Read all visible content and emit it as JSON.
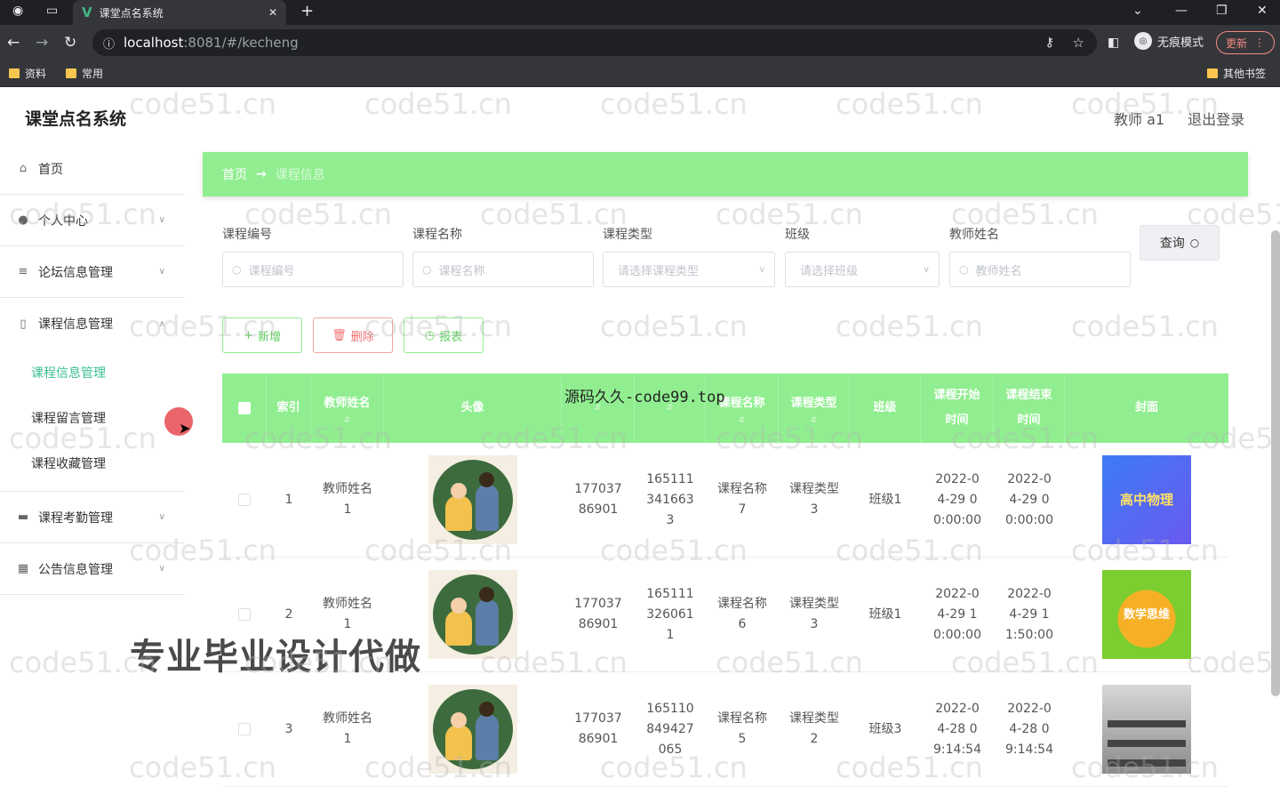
{
  "browser": {
    "tab_title": "课堂点名系统",
    "url_host": "localhost",
    "url_path": ":8081/#/kecheng",
    "incognito_label": "无痕模式",
    "update_label": "更新",
    "bookmarks": [
      "资料",
      "常用"
    ],
    "other_bookmarks": "其他书签"
  },
  "app": {
    "brand": "课堂点名系统",
    "user": "教师 a1",
    "logout": "退出登录"
  },
  "sidebar": {
    "items": [
      {
        "label": "首页",
        "icon": "home-icon"
      },
      {
        "label": "个人中心",
        "icon": "user-icon"
      },
      {
        "label": "论坛信息管理",
        "icon": "menu-icon"
      },
      {
        "label": "课程信息管理",
        "icon": "book-icon"
      },
      {
        "label": "课程考勤管理",
        "icon": "briefcase-icon"
      },
      {
        "label": "公告信息管理",
        "icon": "grid-icon"
      }
    ],
    "subitems": [
      "课程信息管理",
      "课程留言管理",
      "课程收藏管理"
    ]
  },
  "breadcrumb": {
    "home": "首页",
    "sep": "→",
    "current": "课程信息"
  },
  "search": {
    "fields": [
      {
        "label": "课程编号",
        "placeholder": "课程编号",
        "type": "input"
      },
      {
        "label": "课程名称",
        "placeholder": "课程名称",
        "type": "input"
      },
      {
        "label": "课程类型",
        "placeholder": "请选择课程类型",
        "type": "select"
      },
      {
        "label": "班级",
        "placeholder": "请选择班级",
        "type": "select"
      },
      {
        "label": "教师姓名",
        "placeholder": "教师姓名",
        "type": "input"
      }
    ],
    "query_label": "查询"
  },
  "actions": {
    "add": "新增",
    "delete": "删除",
    "report": "报表"
  },
  "table": {
    "headers": [
      "索引",
      "教师姓名",
      "头像",
      "",
      "",
      "课程名称",
      "课程类型",
      "班级",
      "课程开始时间",
      "课程结束时间",
      "封面"
    ],
    "rows": [
      {
        "index": "1",
        "teacher": "教师姓名1",
        "phone": "17703786901",
        "code": "1651113416633",
        "name": "课程名称7",
        "type": "课程类型3",
        "class": "班级1",
        "start": "2022-04-29 00:00:00",
        "end": "2022-04-29 00:00:00",
        "cover_text": "高中物理"
      },
      {
        "index": "2",
        "teacher": "教师姓名1",
        "phone": "17703786901",
        "code": "1651113260611",
        "name": "课程名称6",
        "type": "课程类型3",
        "class": "班级1",
        "start": "2022-04-29 10:00:00",
        "end": "2022-04-29 11:50:00",
        "cover_text": "数学思维"
      },
      {
        "index": "3",
        "teacher": "教师姓名1",
        "phone": "17703786901",
        "code": "165110849427065",
        "name": "课程名称5",
        "type": "课程类型2",
        "class": "班级3",
        "start": "2022-04-28 09:14:54",
        "end": "2022-04-28 09:14:54",
        "cover_text": ""
      }
    ]
  },
  "overlays": {
    "top_text": "源码久久-code99.top",
    "bottom_text": "专业毕业设计代做",
    "watermark": "code51.cn"
  }
}
